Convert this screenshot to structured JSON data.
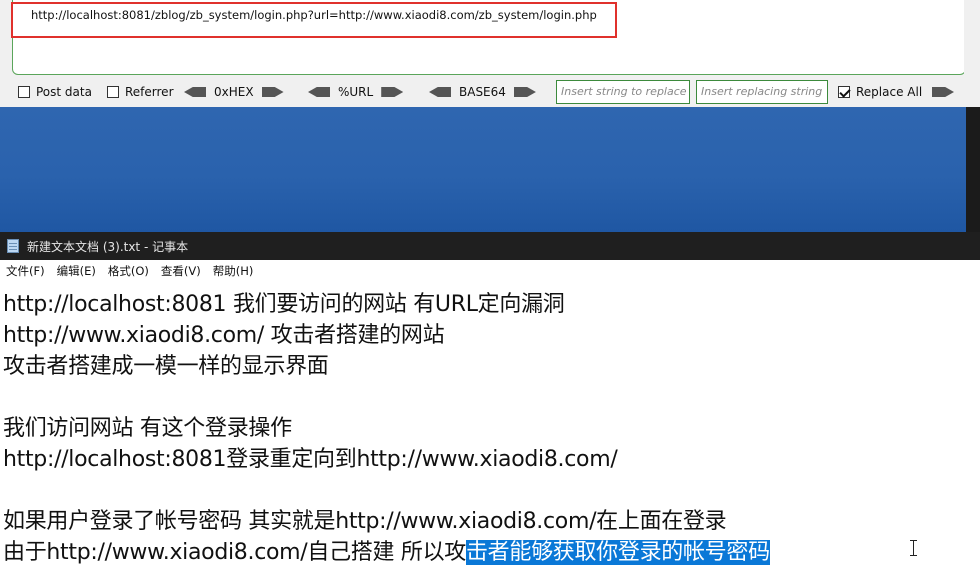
{
  "hackbar": {
    "url": "http://localhost:8081/zblog/zb_system/login.php?url=http://www.xiaodi8.com/zb_system/login.php",
    "post_data_label": "Post data",
    "post_data_checked": false,
    "referrer_label": "Referrer",
    "referrer_checked": false,
    "hex_label": "0xHEX",
    "url_label": "%URL",
    "base64_label": "BASE64",
    "find_placeholder": "Insert string to replace",
    "replace_placeholder": "Insert replacing string",
    "replace_all_label": "Replace All",
    "replace_all_checked": true
  },
  "notepad": {
    "title": "新建文本文档 (3).txt - 记事本",
    "menu": [
      "文件(F)",
      "编辑(E)",
      "格式(O)",
      "查看(V)",
      "帮助(H)"
    ],
    "lines": [
      "http://localhost:8081 我们要访问的网站 有URL定向漏洞",
      "http://www.xiaodi8.com/ 攻击者搭建的网站",
      "攻击者搭建成一模一样的显示界面",
      "",
      "我们访问网站 有这个登录操作",
      "http://localhost:8081登录重定向到http://www.xiaodi8.com/",
      "",
      "如果用户登录了帐号密码 其实就是http://www.xiaodi8.com/在上面在登录"
    ],
    "last_line_plain": "由于http://www.xiaodi8.com/自己搭建 所以攻",
    "last_line_selected": "击者能够获取你登录的帐号密码"
  },
  "colors": {
    "highlight_box": "#e0312c",
    "hackbar_border": "#3c8a3c",
    "desktop_blue": "#2a62ad",
    "selection": "#0a78d7"
  }
}
